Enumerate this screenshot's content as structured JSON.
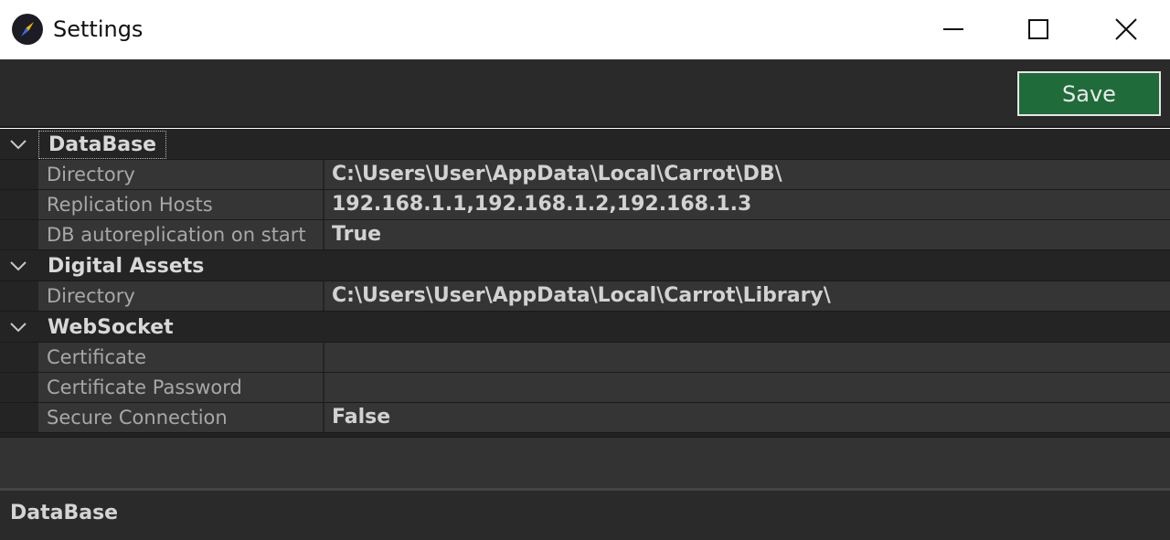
{
  "window": {
    "title": "Settings",
    "icon": "compass-icon",
    "controls": [
      "minimize-icon",
      "maximize-icon",
      "close-icon"
    ]
  },
  "toolbar": {
    "save_label": "Save",
    "save_color": "#1f6b3a"
  },
  "property_grid": {
    "categories": [
      {
        "label": "DataBase",
        "expanded": true,
        "properties": [
          {
            "name": "Directory",
            "value": "C:\\Users\\User\\AppData\\Local\\Carrot\\DB\\"
          },
          {
            "name": "Replication Hosts",
            "value": "192.168.1.1,192.168.1.2,192.168.1.3"
          },
          {
            "name": "DB autoreplication on start",
            "value": "True"
          }
        ]
      },
      {
        "label": "Digital Assets",
        "expanded": true,
        "properties": [
          {
            "name": "Directory",
            "value": "C:\\Users\\User\\AppData\\Local\\Carrot\\Library\\"
          }
        ]
      },
      {
        "label": "WebSocket",
        "expanded": true,
        "properties": [
          {
            "name": "Certificate",
            "value": ""
          },
          {
            "name": "Certificate Password",
            "value": ""
          },
          {
            "name": "Secure Connection",
            "value": "False"
          }
        ]
      }
    ]
  },
  "description": {
    "title": "DataBase"
  }
}
